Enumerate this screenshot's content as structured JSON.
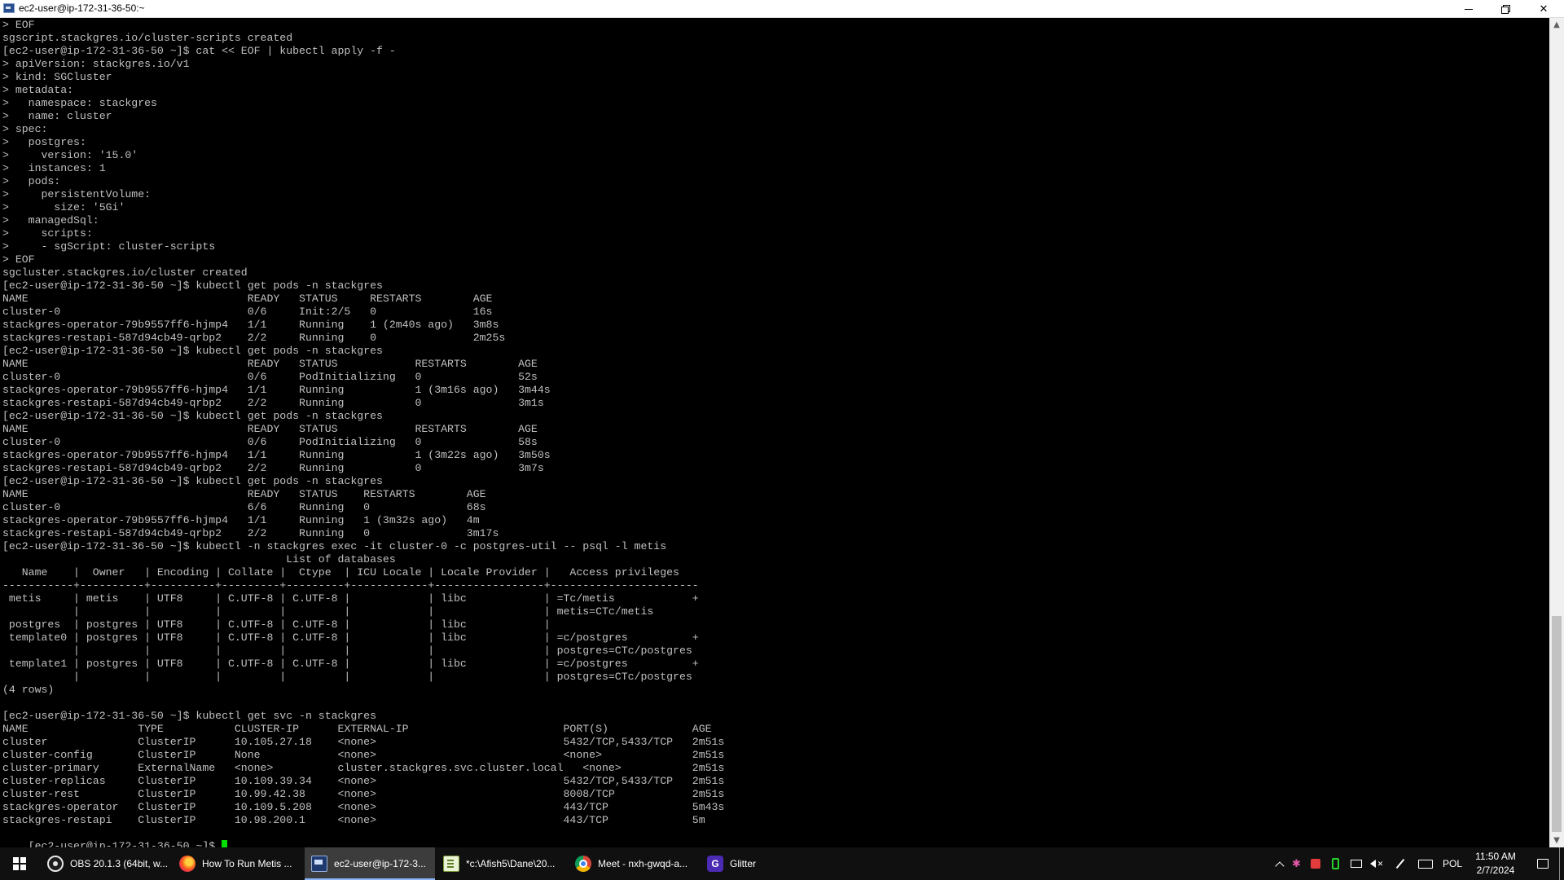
{
  "window": {
    "title": "ec2-user@ip-172-31-36-50:~"
  },
  "terminal": {
    "lines": [
      "> EOF",
      "sgscript.stackgres.io/cluster-scripts created",
      "[ec2-user@ip-172-31-36-50 ~]$ cat << EOF | kubectl apply -f -",
      "> apiVersion: stackgres.io/v1",
      "> kind: SGCluster",
      "> metadata:",
      ">   namespace: stackgres",
      ">   name: cluster",
      "> spec:",
      ">   postgres:",
      ">     version: '15.0'",
      ">   instances: 1",
      ">   pods:",
      ">     persistentVolume:",
      ">       size: '5Gi'",
      ">   managedSql:",
      ">     scripts:",
      ">     - sgScript: cluster-scripts",
      "> EOF",
      "sgcluster.stackgres.io/cluster created",
      "[ec2-user@ip-172-31-36-50 ~]$ kubectl get pods -n stackgres",
      "NAME                                  READY   STATUS     RESTARTS        AGE",
      "cluster-0                             0/6     Init:2/5   0               16s",
      "stackgres-operator-79b9557ff6-hjmp4   1/1     Running    1 (2m40s ago)   3m8s",
      "stackgres-restapi-587d94cb49-qrbp2    2/2     Running    0               2m25s",
      "[ec2-user@ip-172-31-36-50 ~]$ kubectl get pods -n stackgres",
      "NAME                                  READY   STATUS            RESTARTS        AGE",
      "cluster-0                             0/6     PodInitializing   0               52s",
      "stackgres-operator-79b9557ff6-hjmp4   1/1     Running           1 (3m16s ago)   3m44s",
      "stackgres-restapi-587d94cb49-qrbp2    2/2     Running           0               3m1s",
      "[ec2-user@ip-172-31-36-50 ~]$ kubectl get pods -n stackgres",
      "NAME                                  READY   STATUS            RESTARTS        AGE",
      "cluster-0                             0/6     PodInitializing   0               58s",
      "stackgres-operator-79b9557ff6-hjmp4   1/1     Running           1 (3m22s ago)   3m50s",
      "stackgres-restapi-587d94cb49-qrbp2    2/2     Running           0               3m7s",
      "[ec2-user@ip-172-31-36-50 ~]$ kubectl get pods -n stackgres",
      "NAME                                  READY   STATUS    RESTARTS        AGE",
      "cluster-0                             6/6     Running   0               68s",
      "stackgres-operator-79b9557ff6-hjmp4   1/1     Running   1 (3m32s ago)   4m",
      "stackgres-restapi-587d94cb49-qrbp2    2/2     Running   0               3m17s",
      "[ec2-user@ip-172-31-36-50 ~]$ kubectl -n stackgres exec -it cluster-0 -c postgres-util -- psql -l metis",
      "                                            List of databases",
      "   Name    |  Owner   | Encoding | Collate |  Ctype  | ICU Locale | Locale Provider |   Access privileges",
      "-----------+----------+----------+---------+---------+------------+-----------------+-----------------------",
      " metis     | metis    | UTF8     | C.UTF-8 | C.UTF-8 |            | libc            | =Tc/metis            +",
      "           |          |          |         |         |            |                 | metis=CTc/metis",
      " postgres  | postgres | UTF8     | C.UTF-8 | C.UTF-8 |            | libc            |",
      " template0 | postgres | UTF8     | C.UTF-8 | C.UTF-8 |            | libc            | =c/postgres          +",
      "           |          |          |         |         |            |                 | postgres=CTc/postgres",
      " template1 | postgres | UTF8     | C.UTF-8 | C.UTF-8 |            | libc            | =c/postgres          +",
      "           |          |          |         |         |            |                 | postgres=CTc/postgres",
      "(4 rows)",
      "",
      "[ec2-user@ip-172-31-36-50 ~]$ kubectl get svc -n stackgres",
      "NAME                 TYPE           CLUSTER-IP      EXTERNAL-IP                        PORT(S)             AGE",
      "cluster              ClusterIP      10.105.27.18    <none>                             5432/TCP,5433/TCP   2m51s",
      "cluster-config       ClusterIP      None            <none>                             <none>              2m51s",
      "cluster-primary      ExternalName   <none>          cluster.stackgres.svc.cluster.local   <none>           2m51s",
      "cluster-replicas     ClusterIP      10.109.39.34    <none>                             5432/TCP,5433/TCP   2m51s",
      "cluster-rest         ClusterIP      10.99.42.38     <none>                             8008/TCP            2m51s",
      "stackgres-operator   ClusterIP      10.109.5.208    <none>                             443/TCP             5m43s",
      "stackgres-restapi    ClusterIP      10.98.200.1     <none>                             443/TCP             5m"
    ],
    "prompt": "[ec2-user@ip-172-31-36-50 ~]$ ",
    "cursor_color": "#00e000",
    "text_color": "#c0c0c0",
    "background": "#000000"
  },
  "taskbar": {
    "items": [
      {
        "label": "OBS 20.1.3 (64bit, w...",
        "icon": "obs-icon"
      },
      {
        "label": "How To Run Metis ...",
        "icon": "firefox-icon"
      },
      {
        "label": "ec2-user@ip-172-3...",
        "icon": "putty-icon",
        "active": true
      },
      {
        "label": "*c:\\Afish5\\Dane\\20...",
        "icon": "notepad-icon"
      },
      {
        "label": "Meet - nxh-gwqd-a...",
        "icon": "chrome-icon"
      },
      {
        "label": "Glitter",
        "icon": "glitter-icon"
      }
    ],
    "tray": {
      "language": "POL",
      "time": "11:50 AM",
      "date": "2/7/2024"
    }
  }
}
